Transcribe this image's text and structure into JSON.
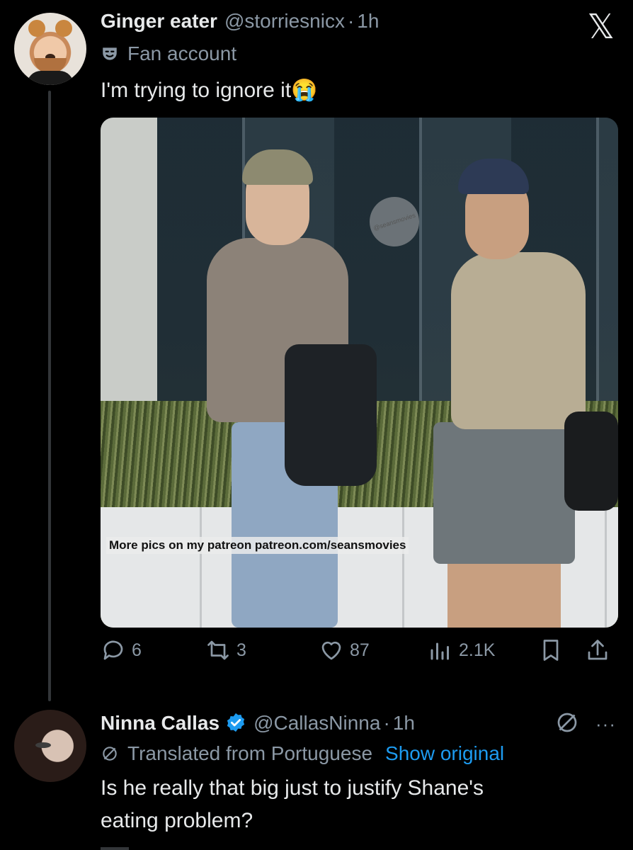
{
  "post": {
    "display_name": "Ginger eater",
    "handle": "@storriesnicx",
    "separator": "·",
    "time": "1h",
    "account_label": "Fan account",
    "text": "I'm trying to ignore it😭",
    "media": {
      "watermark": "@seansmovies",
      "caption": "More pics on my patreon  patreon.com/seansmovies"
    },
    "stats": {
      "replies": "6",
      "reposts": "3",
      "likes": "87",
      "views": "2.1K"
    }
  },
  "reply": {
    "display_name": "Ninna Callas",
    "handle": "@CallasNinna",
    "separator": "·",
    "time": "1h",
    "translated_label": "Translated from Portuguese",
    "show_original": "Show original",
    "text_line1": "Is he really that big just to justify Shane's",
    "text_line2": "eating problem?",
    "more": "···"
  },
  "brand": {
    "logo": "𝕏",
    "accent": "#1d9bf0",
    "muted": "#8b98a5",
    "text": "#e7e9ea",
    "background": "#000000"
  }
}
